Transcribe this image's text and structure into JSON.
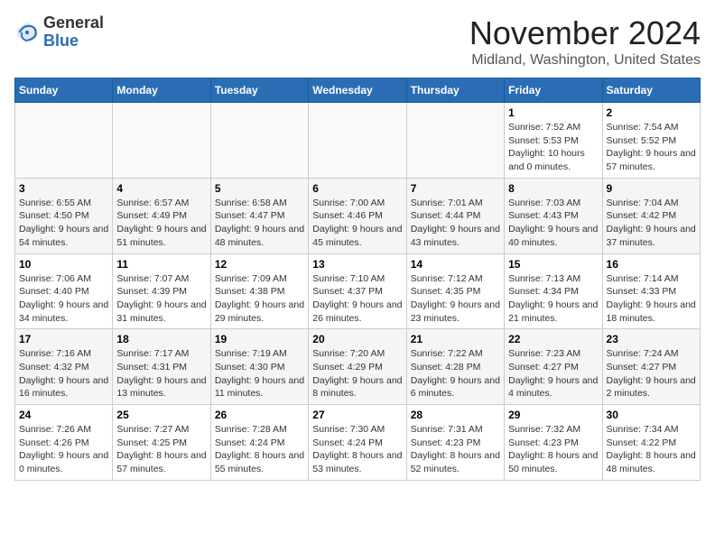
{
  "header": {
    "logo_line1": "General",
    "logo_line2": "Blue",
    "month": "November 2024",
    "location": "Midland, Washington, United States"
  },
  "weekdays": [
    "Sunday",
    "Monday",
    "Tuesday",
    "Wednesday",
    "Thursday",
    "Friday",
    "Saturday"
  ],
  "weeks": [
    {
      "days": [
        {
          "num": "",
          "info": ""
        },
        {
          "num": "",
          "info": ""
        },
        {
          "num": "",
          "info": ""
        },
        {
          "num": "",
          "info": ""
        },
        {
          "num": "",
          "info": ""
        },
        {
          "num": "1",
          "info": "Sunrise: 7:52 AM\nSunset: 5:53 PM\nDaylight: 10 hours and 0 minutes."
        },
        {
          "num": "2",
          "info": "Sunrise: 7:54 AM\nSunset: 5:52 PM\nDaylight: 9 hours and 57 minutes."
        }
      ]
    },
    {
      "days": [
        {
          "num": "3",
          "info": "Sunrise: 6:55 AM\nSunset: 4:50 PM\nDaylight: 9 hours and 54 minutes."
        },
        {
          "num": "4",
          "info": "Sunrise: 6:57 AM\nSunset: 4:49 PM\nDaylight: 9 hours and 51 minutes."
        },
        {
          "num": "5",
          "info": "Sunrise: 6:58 AM\nSunset: 4:47 PM\nDaylight: 9 hours and 48 minutes."
        },
        {
          "num": "6",
          "info": "Sunrise: 7:00 AM\nSunset: 4:46 PM\nDaylight: 9 hours and 45 minutes."
        },
        {
          "num": "7",
          "info": "Sunrise: 7:01 AM\nSunset: 4:44 PM\nDaylight: 9 hours and 43 minutes."
        },
        {
          "num": "8",
          "info": "Sunrise: 7:03 AM\nSunset: 4:43 PM\nDaylight: 9 hours and 40 minutes."
        },
        {
          "num": "9",
          "info": "Sunrise: 7:04 AM\nSunset: 4:42 PM\nDaylight: 9 hours and 37 minutes."
        }
      ]
    },
    {
      "days": [
        {
          "num": "10",
          "info": "Sunrise: 7:06 AM\nSunset: 4:40 PM\nDaylight: 9 hours and 34 minutes."
        },
        {
          "num": "11",
          "info": "Sunrise: 7:07 AM\nSunset: 4:39 PM\nDaylight: 9 hours and 31 minutes."
        },
        {
          "num": "12",
          "info": "Sunrise: 7:09 AM\nSunset: 4:38 PM\nDaylight: 9 hours and 29 minutes."
        },
        {
          "num": "13",
          "info": "Sunrise: 7:10 AM\nSunset: 4:37 PM\nDaylight: 9 hours and 26 minutes."
        },
        {
          "num": "14",
          "info": "Sunrise: 7:12 AM\nSunset: 4:35 PM\nDaylight: 9 hours and 23 minutes."
        },
        {
          "num": "15",
          "info": "Sunrise: 7:13 AM\nSunset: 4:34 PM\nDaylight: 9 hours and 21 minutes."
        },
        {
          "num": "16",
          "info": "Sunrise: 7:14 AM\nSunset: 4:33 PM\nDaylight: 9 hours and 18 minutes."
        }
      ]
    },
    {
      "days": [
        {
          "num": "17",
          "info": "Sunrise: 7:16 AM\nSunset: 4:32 PM\nDaylight: 9 hours and 16 minutes."
        },
        {
          "num": "18",
          "info": "Sunrise: 7:17 AM\nSunset: 4:31 PM\nDaylight: 9 hours and 13 minutes."
        },
        {
          "num": "19",
          "info": "Sunrise: 7:19 AM\nSunset: 4:30 PM\nDaylight: 9 hours and 11 minutes."
        },
        {
          "num": "20",
          "info": "Sunrise: 7:20 AM\nSunset: 4:29 PM\nDaylight: 9 hours and 8 minutes."
        },
        {
          "num": "21",
          "info": "Sunrise: 7:22 AM\nSunset: 4:28 PM\nDaylight: 9 hours and 6 minutes."
        },
        {
          "num": "22",
          "info": "Sunrise: 7:23 AM\nSunset: 4:27 PM\nDaylight: 9 hours and 4 minutes."
        },
        {
          "num": "23",
          "info": "Sunrise: 7:24 AM\nSunset: 4:27 PM\nDaylight: 9 hours and 2 minutes."
        }
      ]
    },
    {
      "days": [
        {
          "num": "24",
          "info": "Sunrise: 7:26 AM\nSunset: 4:26 PM\nDaylight: 9 hours and 0 minutes."
        },
        {
          "num": "25",
          "info": "Sunrise: 7:27 AM\nSunset: 4:25 PM\nDaylight: 8 hours and 57 minutes."
        },
        {
          "num": "26",
          "info": "Sunrise: 7:28 AM\nSunset: 4:24 PM\nDaylight: 8 hours and 55 minutes."
        },
        {
          "num": "27",
          "info": "Sunrise: 7:30 AM\nSunset: 4:24 PM\nDaylight: 8 hours and 53 minutes."
        },
        {
          "num": "28",
          "info": "Sunrise: 7:31 AM\nSunset: 4:23 PM\nDaylight: 8 hours and 52 minutes."
        },
        {
          "num": "29",
          "info": "Sunrise: 7:32 AM\nSunset: 4:23 PM\nDaylight: 8 hours and 50 minutes."
        },
        {
          "num": "30",
          "info": "Sunrise: 7:34 AM\nSunset: 4:22 PM\nDaylight: 8 hours and 48 minutes."
        }
      ]
    }
  ]
}
